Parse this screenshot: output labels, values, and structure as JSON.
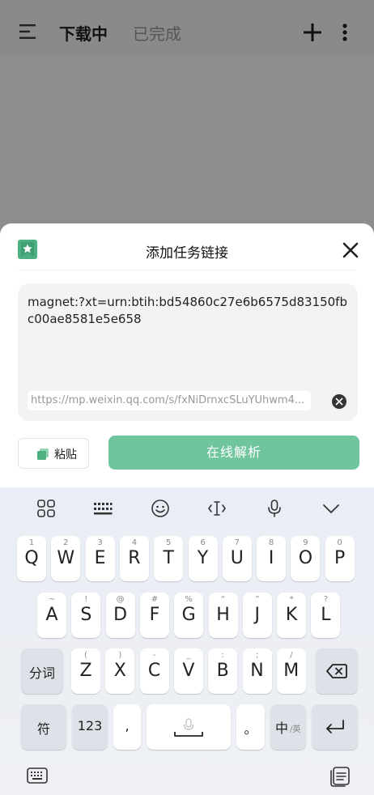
{
  "topbar": {
    "tabs": [
      {
        "label": "下载中"
      },
      {
        "label": "已完成"
      }
    ]
  },
  "dialog": {
    "title": "添加任务链接",
    "magnet_text": "magnet:?xt=urn:btih:bd54860c27e6b6575d83150fbc00ae8581e5e658",
    "link_value": "https://mp.weixin.qq.com/s/fxNiDrnxcSLuYUhwm4...",
    "paste_label": "粘贴",
    "parse_label": "在线解析"
  },
  "keyboard": {
    "row1": [
      {
        "sub": "1",
        "main": "Q"
      },
      {
        "sub": "2",
        "main": "W"
      },
      {
        "sub": "3",
        "main": "E"
      },
      {
        "sub": "4",
        "main": "R"
      },
      {
        "sub": "5",
        "main": "T"
      },
      {
        "sub": "6",
        "main": "Y"
      },
      {
        "sub": "7",
        "main": "U"
      },
      {
        "sub": "8",
        "main": "I"
      },
      {
        "sub": "9",
        "main": "O"
      },
      {
        "sub": "0",
        "main": "P"
      }
    ],
    "row2": [
      {
        "sub": "~",
        "main": "A"
      },
      {
        "sub": "!",
        "main": "S"
      },
      {
        "sub": "@",
        "main": "D"
      },
      {
        "sub": "#",
        "main": "F"
      },
      {
        "sub": "%",
        "main": "G"
      },
      {
        "sub": "“",
        "main": "H"
      },
      {
        "sub": "”",
        "main": "J"
      },
      {
        "sub": "*",
        "main": "K"
      },
      {
        "sub": "?",
        "main": "L"
      }
    ],
    "row3_left": "分词",
    "row3": [
      {
        "sub": "(",
        "main": "Z"
      },
      {
        "sub": ")",
        "main": "X"
      },
      {
        "sub": "-",
        "main": "C"
      },
      {
        "sub": "_",
        "main": "V"
      },
      {
        "sub": ":",
        "main": "B"
      },
      {
        "sub": ";",
        "main": "N"
      },
      {
        "sub": "/",
        "main": "M"
      }
    ],
    "symbol_key": "符",
    "number_key": "123",
    "comma_key": ",",
    "period_key": "。",
    "lang_key_main": "中",
    "lang_key_sub": "/英"
  }
}
